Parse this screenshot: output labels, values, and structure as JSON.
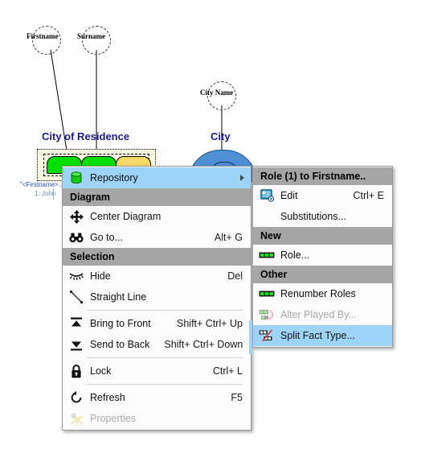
{
  "diagram": {
    "title_left": "City of Residence",
    "title_right": "City",
    "object_types": [
      {
        "label": "Firstname"
      },
      {
        "label": "Surname"
      },
      {
        "label": "City Name"
      }
    ],
    "verbalization": "\"<Firstname>...",
    "sample_row": "1:  John",
    "colors": {
      "role_green": "#00dd00",
      "role_yellow": "#f5d967",
      "entity_blue": "#4f8fd6",
      "title_blue": "#1a1a8c",
      "fact_background": "#fbfbe4"
    }
  },
  "context_menu": {
    "items": [
      {
        "kind": "item",
        "name": "repository",
        "label": "Repository",
        "accel": "",
        "icon": "database-icon",
        "selected": true,
        "disabled": false,
        "submenu": true
      },
      {
        "kind": "header",
        "name": "diagram",
        "label": "Diagram"
      },
      {
        "kind": "item",
        "name": "center-diagram",
        "label": "Center Diagram",
        "accel": "",
        "icon": "move-arrows-icon",
        "selected": false,
        "disabled": false,
        "submenu": false
      },
      {
        "kind": "item",
        "name": "go-to",
        "label": "Go to...",
        "accel": "Alt+ G",
        "icon": "binoculars-icon",
        "selected": false,
        "disabled": false,
        "submenu": false
      },
      {
        "kind": "header",
        "name": "selection",
        "label": "Selection"
      },
      {
        "kind": "item",
        "name": "hide",
        "label": "Hide",
        "accel": "Del",
        "icon": "closed-eye-icon",
        "selected": false,
        "disabled": false,
        "submenu": false
      },
      {
        "kind": "item",
        "name": "straight-line",
        "label": "Straight Line",
        "accel": "",
        "icon": "diagonal-line-icon",
        "selected": false,
        "disabled": false,
        "submenu": false
      },
      {
        "kind": "separator",
        "name": "separator-1"
      },
      {
        "kind": "item",
        "name": "bring-to-front",
        "label": "Bring to Front",
        "accel": "Shift+ Ctrl+ Up",
        "icon": "bring-to-front-icon",
        "selected": false,
        "disabled": false,
        "submenu": false
      },
      {
        "kind": "item",
        "name": "send-to-back",
        "label": "Send to Back",
        "accel": "Shift+ Ctrl+ Down",
        "icon": "send-to-back-icon",
        "selected": false,
        "disabled": false,
        "submenu": false
      },
      {
        "kind": "separator",
        "name": "separator-2"
      },
      {
        "kind": "item",
        "name": "lock",
        "label": "Lock",
        "accel": "Ctrl+ L",
        "icon": "padlock-icon",
        "selected": false,
        "disabled": false,
        "submenu": false
      },
      {
        "kind": "separator",
        "name": "separator-3"
      },
      {
        "kind": "item",
        "name": "refresh",
        "label": "Refresh",
        "accel": "F5",
        "icon": "refresh-icon",
        "selected": false,
        "disabled": false,
        "submenu": false
      },
      {
        "kind": "item",
        "name": "properties",
        "label": "Properties",
        "accel": "",
        "icon": "properties-icon",
        "selected": false,
        "disabled": true,
        "submenu": false
      }
    ]
  },
  "submenu": {
    "items": [
      {
        "kind": "header",
        "name": "role-1-to-firstname",
        "label": "Role (1) to Firstname.."
      },
      {
        "kind": "item",
        "name": "edit",
        "label": "Edit",
        "accel": "Ctrl+ E",
        "icon": "edit-card-icon",
        "selected": false,
        "disabled": false
      },
      {
        "kind": "item",
        "name": "substitutions",
        "label": "Substitutions...",
        "accel": "",
        "icon": "none-icon",
        "selected": false,
        "disabled": false
      },
      {
        "kind": "header",
        "name": "new",
        "label": "New"
      },
      {
        "kind": "item",
        "name": "role",
        "label": "Role...",
        "accel": "",
        "icon": "role-boxes-icon",
        "selected": false,
        "disabled": false
      },
      {
        "kind": "header",
        "name": "other",
        "label": "Other"
      },
      {
        "kind": "item",
        "name": "renumber-roles",
        "label": "Renumber Roles",
        "accel": "",
        "icon": "role-boxes-icon",
        "selected": false,
        "disabled": false
      },
      {
        "kind": "item",
        "name": "alter-played-by",
        "label": "Alter Played By...",
        "accel": "",
        "icon": "alter-played-by-icon",
        "selected": false,
        "disabled": true
      },
      {
        "kind": "item",
        "name": "split-fact-type",
        "label": "Split Fact Type...",
        "accel": "",
        "icon": "split-fact-type-icon",
        "selected": true,
        "disabled": false
      }
    ]
  },
  "theme": {
    "menu_highlight": "#9ed4f7",
    "menu_header_bg": "#a6a6a6",
    "menu_bg": "#fbfbfb",
    "menu_border": "#9b9b9b"
  }
}
